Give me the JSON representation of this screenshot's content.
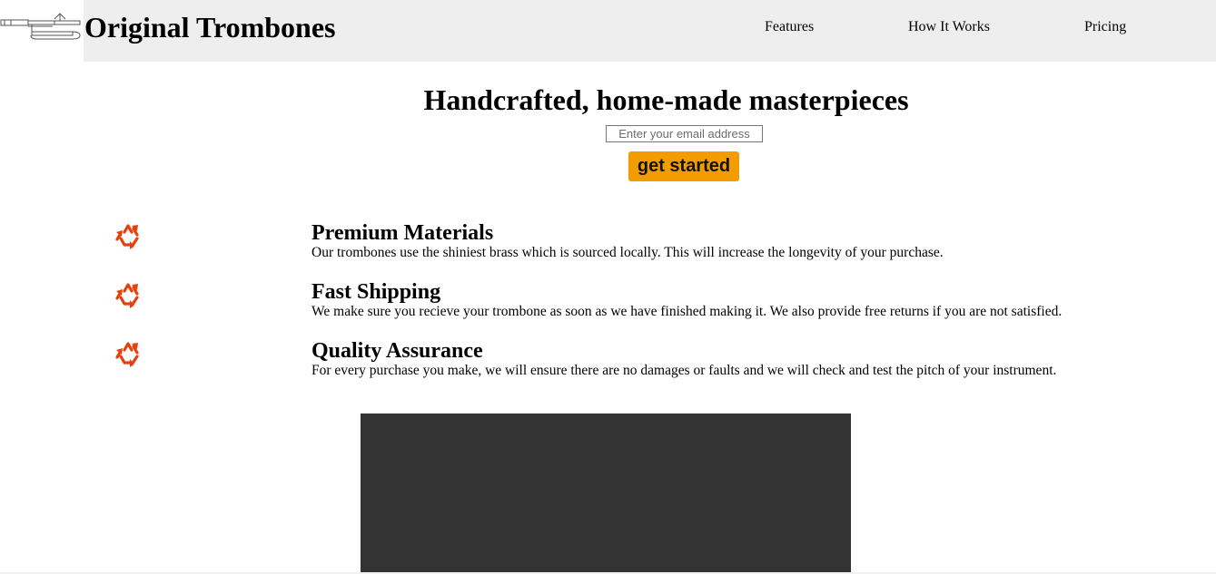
{
  "brand": {
    "name": "Original Trombones",
    "logo_icon": "trombone-icon"
  },
  "nav": {
    "items": [
      {
        "label": "Features"
      },
      {
        "label": "How It Works"
      },
      {
        "label": "Pricing"
      }
    ]
  },
  "hero": {
    "title": "Handcrafted, home-made masterpieces",
    "email_placeholder": "Enter your email address",
    "email_value": "",
    "cta_label": "get started",
    "cta_color": "#f39c00"
  },
  "features": [
    {
      "icon": "recycle-icon",
      "title": "Premium Materials",
      "description": "Our trombones use the shiniest brass which is sourced locally. This will increase the longevity of your purchase."
    },
    {
      "icon": "recycle-icon",
      "title": "Fast Shipping",
      "description": "We make sure you recieve your trombone as soon as we have finished making it. We also provide free returns if you are not satisfied."
    },
    {
      "icon": "recycle-icon",
      "title": "Quality Assurance",
      "description": "For every purchase you make, we will ensure there are no damages or faults and we will check and test the pitch of your instrument."
    }
  ],
  "colors": {
    "icon": "#e8400c",
    "header_bg": "#eeeeee",
    "video_bg": "#333333"
  }
}
